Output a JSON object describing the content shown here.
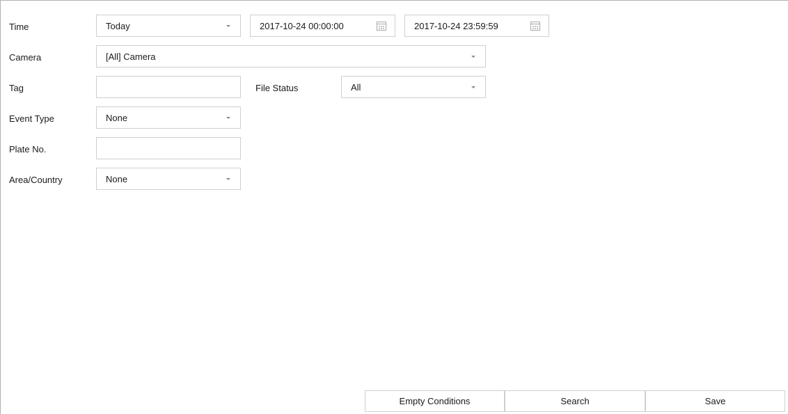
{
  "form": {
    "time": {
      "label": "Time",
      "range_value": "Today",
      "start": "2017-10-24 00:00:00",
      "end": "2017-10-24 23:59:59"
    },
    "camera": {
      "label": "Camera",
      "value": "[All] Camera"
    },
    "tag": {
      "label": "Tag",
      "value": ""
    },
    "file_status": {
      "label": "File Status",
      "value": "All"
    },
    "event_type": {
      "label": "Event Type",
      "value": "None"
    },
    "plate_no": {
      "label": "Plate No.",
      "value": ""
    },
    "area_country": {
      "label": "Area/Country",
      "value": "None"
    }
  },
  "buttons": {
    "empty_conditions": "Empty Conditions",
    "search": "Search",
    "save": "Save"
  },
  "icons": {
    "dropdown": "chevron-down-icon",
    "calendar": "calendar-icon"
  }
}
